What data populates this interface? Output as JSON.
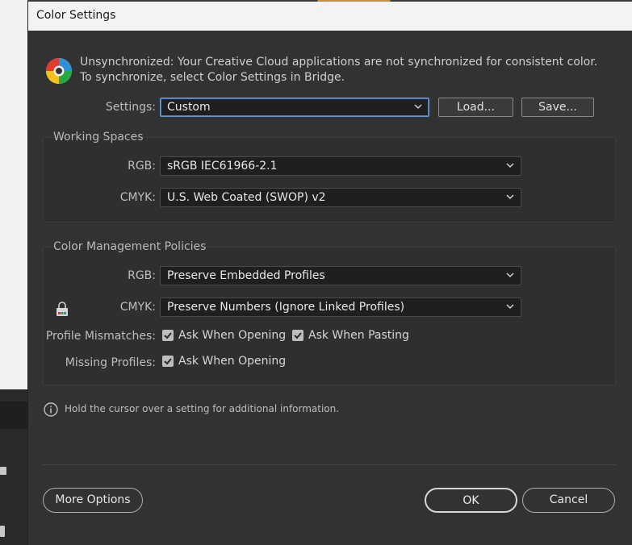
{
  "dialog": {
    "title": "Color Settings"
  },
  "message": {
    "text": "Unsynchronized: Your Creative Cloud applications are not synchronized for consistent color. To synchronize, select Color Settings in Bridge.",
    "icon": "creative-cloud-sync-icon"
  },
  "settings": {
    "label": "Settings:",
    "value": "Custom",
    "load_label": "Load...",
    "save_label": "Save..."
  },
  "working_spaces": {
    "title": "Working Spaces",
    "rgb_label": "RGB:",
    "rgb_value": "sRGB IEC61966-2.1",
    "cmyk_label": "CMYK:",
    "cmyk_value": "U.S. Web Coated (SWOP) v2"
  },
  "policies": {
    "title": "Color Management Policies",
    "rgb_label": "RGB:",
    "rgb_value": "Preserve Embedded Profiles",
    "cmyk_label": "CMYK:",
    "cmyk_value": "Preserve Numbers (Ignore Linked Profiles)",
    "mismatch_label": "Profile Mismatches:",
    "ask_opening_label": "Ask When Opening",
    "ask_pasting_label": "Ask When Pasting",
    "missing_label": "Missing Profiles:",
    "missing_ask_opening_label": "Ask When Opening"
  },
  "info": {
    "text": "Hold the cursor over a setting for additional information."
  },
  "footer": {
    "more_options_label": "More Options",
    "ok_label": "OK",
    "cancel_label": "Cancel"
  },
  "colors": {
    "dialog_bg": "#323232",
    "select_bg": "#1f1f1f",
    "focus_accent": "#6b9bd6"
  }
}
